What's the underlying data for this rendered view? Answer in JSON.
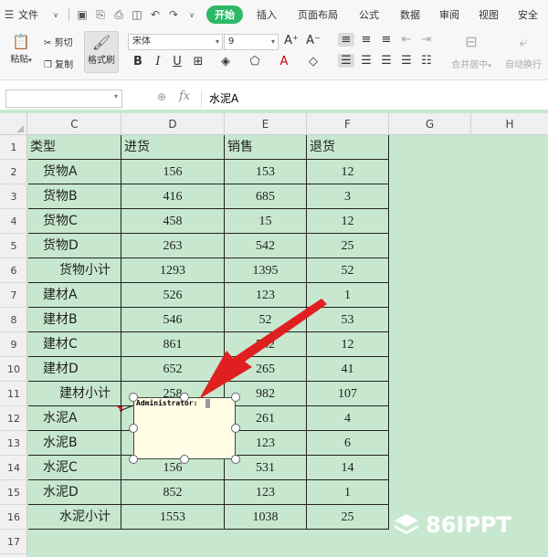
{
  "menubar": {
    "file_label": "文件",
    "tabs": [
      "开始",
      "插入",
      "页面布局",
      "公式",
      "数据",
      "审阅",
      "视图",
      "安全"
    ],
    "active_tab": "开始"
  },
  "ribbon": {
    "paste_label": "粘贴",
    "cut_label": "剪切",
    "copy_label": "复制",
    "format_painter_label": "格式刷",
    "font_name": "宋体",
    "font_size": "9",
    "merge_label": "合并居中",
    "wrap_label": "自动换行"
  },
  "formula_bar": {
    "name_box": "",
    "fx": "fx",
    "content": "水泥A"
  },
  "sheet": {
    "columns": [
      "C",
      "D",
      "E",
      "F",
      "G",
      "H"
    ],
    "rows": [
      {
        "n": "1",
        "c": "类型",
        "d": "进货",
        "e": "销售",
        "f": "退货",
        "indent": 0,
        "header": true
      },
      {
        "n": "2",
        "c": "货物A",
        "d": "156",
        "e": "153",
        "f": "12",
        "indent": 1
      },
      {
        "n": "3",
        "c": "货物B",
        "d": "416",
        "e": "685",
        "f": "3",
        "indent": 1
      },
      {
        "n": "4",
        "c": "货物C",
        "d": "458",
        "e": "15",
        "f": "12",
        "indent": 1
      },
      {
        "n": "5",
        "c": "货物D",
        "d": "263",
        "e": "542",
        "f": "25",
        "indent": 1
      },
      {
        "n": "6",
        "c": "货物小计",
        "d": "1293",
        "e": "1395",
        "f": "52",
        "indent": 2
      },
      {
        "n": "7",
        "c": "建材A",
        "d": "526",
        "e": "123",
        "f": "1",
        "indent": 1
      },
      {
        "n": "8",
        "c": "建材B",
        "d": "546",
        "e": "52",
        "f": "53",
        "indent": 1
      },
      {
        "n": "9",
        "c": "建材C",
        "d": "861",
        "e": "542",
        "f": "12",
        "indent": 1
      },
      {
        "n": "10",
        "c": "建材D",
        "d": "652",
        "e": "265",
        "f": "41",
        "indent": 1
      },
      {
        "n": "11",
        "c": "建材小计",
        "d": "258",
        "e": "982",
        "f": "107",
        "indent": 2
      },
      {
        "n": "12",
        "c": "水泥A",
        "d": "",
        "e": "261",
        "f": "4",
        "indent": 1
      },
      {
        "n": "13",
        "c": "水泥B",
        "d": "",
        "e": "123",
        "f": "6",
        "indent": 1
      },
      {
        "n": "14",
        "c": "水泥C",
        "d": "156",
        "e": "531",
        "f": "14",
        "indent": 1
      },
      {
        "n": "15",
        "c": "水泥D",
        "d": "852",
        "e": "123",
        "f": "1",
        "indent": 1
      },
      {
        "n": "16",
        "c": "水泥小计",
        "d": "1553",
        "e": "1038",
        "f": "25",
        "indent": 2
      },
      {
        "n": "17",
        "c": "",
        "d": "",
        "e": "",
        "f": "",
        "indent": 0,
        "empty": true
      }
    ]
  },
  "comment": {
    "author": "Administrator:"
  },
  "watermark": {
    "text": "86IPPT"
  },
  "colors": {
    "accent": "#2db866",
    "sheet_bg": "#c7e8cf",
    "arrow": "#e02020"
  }
}
